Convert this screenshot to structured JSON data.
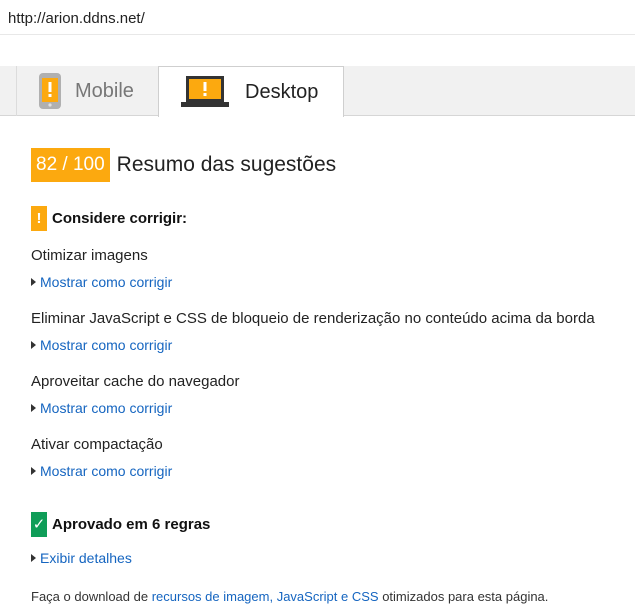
{
  "url": "http://arion.ddns.net/",
  "tabs": [
    {
      "label": "Mobile"
    },
    {
      "label": "Desktop"
    }
  ],
  "score": "82 / 100",
  "summary_title": "Resumo das sugestões",
  "fix_section": {
    "badge": "!",
    "title": "Considere corrigir:",
    "rules": [
      {
        "title": "Otimizar imagens",
        "link": "Mostrar como corrigir"
      },
      {
        "title": "Eliminar JavaScript e CSS de bloqueio de renderização no conteúdo acima da borda",
        "link": "Mostrar como corrigir"
      },
      {
        "title": "Aproveitar cache do navegador",
        "link": "Mostrar como corrigir"
      },
      {
        "title": "Ativar compactação",
        "link": "Mostrar como corrigir"
      }
    ]
  },
  "passed_section": {
    "badge": "✓",
    "title": "Aprovado em 6 regras",
    "link": "Exibir detalhes"
  },
  "footer": {
    "prefix": "Faça o download de ",
    "link": "recursos de imagem, JavaScript e CSS",
    "suffix": " otimizados para esta página."
  },
  "colors": {
    "warning": "#fca90f",
    "passed": "#0f9d58",
    "link": "#1565c0"
  },
  "icons": {
    "mobile_tab": "mobile-phone-warning-icon",
    "desktop_tab": "laptop-warning-icon",
    "expand": "caret-right-icon"
  }
}
